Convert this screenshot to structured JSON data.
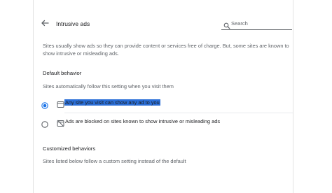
{
  "header": {
    "title": "Intrusive ads",
    "search_placeholder": "Search"
  },
  "description": "Sites usually show ads so they can provide content or services free of charge. But, some sites are known to show intrusive or misleading ads.",
  "default_behavior": {
    "heading": "Default behavior",
    "subheading": "Sites automatically follow this setting when you visit them",
    "options": [
      {
        "label": "Any site you visit can show any ad to you",
        "selected": true,
        "icon": "ad-window-icon"
      },
      {
        "label": "Ads are blocked on sites known to show intrusive or misleading ads",
        "selected": false,
        "icon": "ad-blocked-icon"
      }
    ]
  },
  "customized_behaviors": {
    "heading": "Customized behaviors",
    "subheading": "Sites listed below follow a custom setting instead of the default"
  },
  "colors": {
    "accent": "#1a73e8",
    "selection_highlight": "#2b6fd8"
  }
}
